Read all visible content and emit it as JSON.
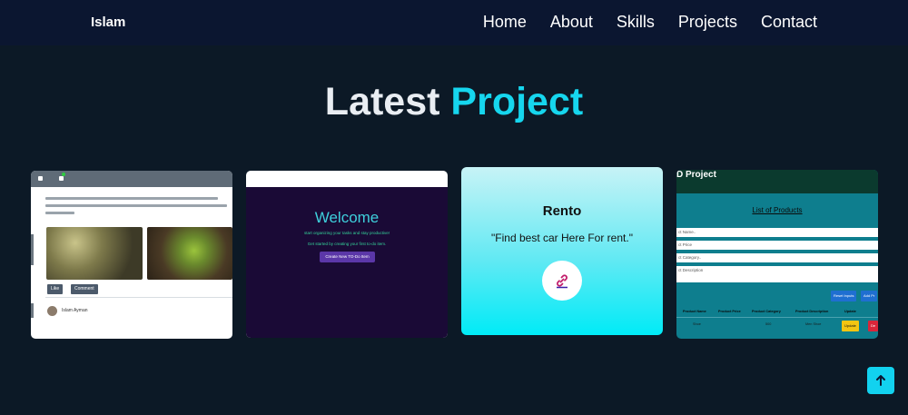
{
  "nav": {
    "brand": "Islam",
    "links": [
      "Home",
      "About",
      "Skills",
      "Projects",
      "Contact"
    ]
  },
  "section": {
    "title_plain": "Latest",
    "title_accent": "Project",
    "accent_color": "#16d6ee"
  },
  "projects": [
    {
      "card": "social-feed",
      "buttons": [
        "Like",
        "Comment"
      ],
      "author": "Islam Ayman"
    },
    {
      "card": "todo-app",
      "heading": "Welcome",
      "line1": "start organizing your tasks and stay productive!",
      "line2": "Get started by creating your first to-do item.",
      "button": "Create New TO-Do Item"
    },
    {
      "card": "rento",
      "name": "Rento",
      "description": "\"Find best car Here For rent.\"",
      "link_icon": "link-icon"
    },
    {
      "card": "crud",
      "header": "D Project",
      "list_title": "List of Products",
      "inputs": [
        "ct Name..",
        "ct Price",
        "ct Category..",
        "ct Description"
      ],
      "buttons": [
        "Reset Inputs",
        "Add Pr"
      ],
      "columns": [
        "Product Name",
        "Product Price",
        "Product Category",
        "Product Description",
        "Update"
      ],
      "row": [
        "Shoe",
        "500",
        "Men Shoe"
      ],
      "row_buttons": [
        "Update",
        "De"
      ]
    }
  ],
  "scroll_top": {
    "icon": "arrow-up-icon"
  }
}
